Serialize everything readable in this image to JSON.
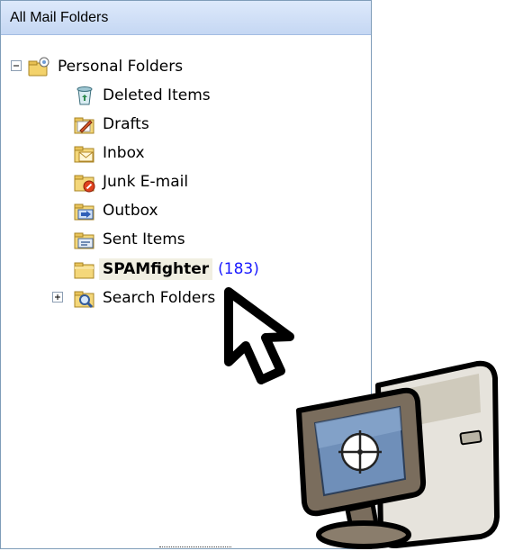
{
  "pane": {
    "title": "All Mail Folders"
  },
  "tree": {
    "root": {
      "label": "Personal Folders",
      "icon": "personal-folders-icon",
      "expanded": true
    },
    "folders": [
      {
        "label": "Deleted Items",
        "icon": "deleted-items-icon"
      },
      {
        "label": "Drafts",
        "icon": "drafts-icon"
      },
      {
        "label": "Inbox",
        "icon": "inbox-icon"
      },
      {
        "label": "Junk E-mail",
        "icon": "junk-email-icon"
      },
      {
        "label": "Outbox",
        "icon": "outbox-icon"
      },
      {
        "label": "Sent Items",
        "icon": "sent-items-icon"
      },
      {
        "label": "SPAMfighter",
        "icon": "folder-icon",
        "count": "(183)",
        "selected": true
      }
    ],
    "search": {
      "label": "Search Folders",
      "icon": "search-folders-icon",
      "expanded": false
    }
  },
  "colors": {
    "header_bg": "#c5d7f3",
    "pane_border": "#7f9db9",
    "count_text": "#1a1aff",
    "selected_bg": "#f1efe2"
  },
  "overlay_icons": [
    "mouse-cursor-icon",
    "computer-monitor-icon"
  ]
}
